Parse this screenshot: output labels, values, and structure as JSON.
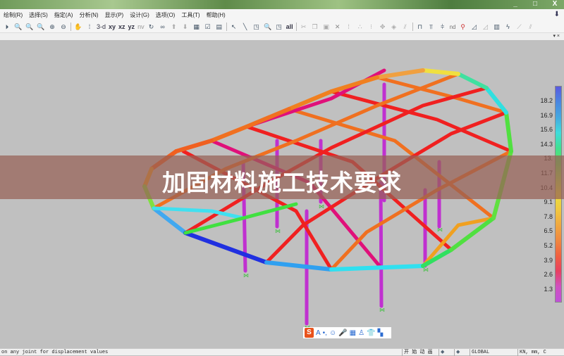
{
  "window": {
    "controls": [
      "_",
      "□",
      "X"
    ]
  },
  "menu": [
    "绘制(R)",
    "选择(S)",
    "指定(A)",
    "分析(N)",
    "显示(P)",
    "设计(G)",
    "选项(O)",
    "工具(T)",
    "帮助(H)"
  ],
  "toolbar": {
    "view_labels": [
      "3-d",
      "xy",
      "xz",
      "yz",
      "nv"
    ],
    "nd_label": "nd",
    "all_label": "all"
  },
  "subbar": {
    "controls": "▾ ×"
  },
  "legend": {
    "labels": [
      "18.2",
      "16.9",
      "15.6",
      "14.3",
      "13.",
      "11.7",
      "10.4",
      "9.1",
      "7.8",
      "6.5",
      "5.2",
      "3.9",
      "2.6",
      "1.3"
    ],
    "colors": [
      "#5a5ae0",
      "#4a86e0",
      "#45a8e0",
      "#40dcdc",
      "#40e090",
      "#60e060",
      "#a8e050",
      "#e8e040",
      "#f0c840",
      "#f0a840",
      "#f08840",
      "#f06040",
      "#e84060",
      "#d050c0",
      "#c050d8"
    ]
  },
  "banner": {
    "title": "加固材料施工技术要求"
  },
  "ime": {
    "logo": "S",
    "items": [
      "A",
      "•,",
      "☺",
      "🎤",
      "▦",
      "♙",
      "👕",
      "▚"
    ]
  },
  "status": {
    "message": "on any joint for displacement values",
    "animate": "开 始 动 画",
    "prev": "◆",
    "next": "◆",
    "coord": "GLOBAL",
    "units": "KN, mm, C"
  }
}
